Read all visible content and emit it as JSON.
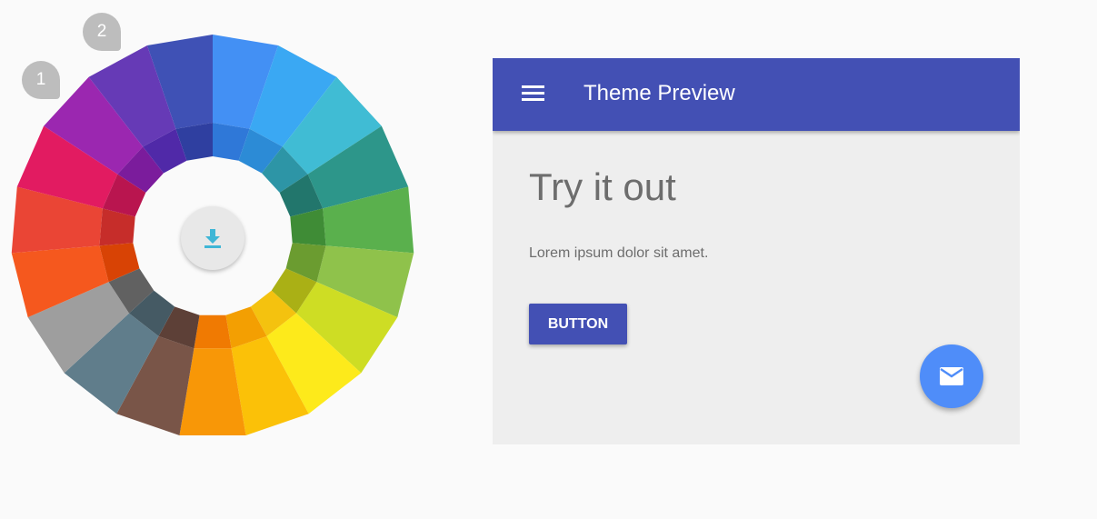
{
  "wheel": {
    "segments": [
      {
        "name": "indigo",
        "outer": "#3f51b5",
        "inner": "#2f3fa0"
      },
      {
        "name": "blue",
        "outer": "#4390f4",
        "inner": "#2f78d8"
      },
      {
        "name": "light-blue",
        "outer": "#3aa8f3",
        "inner": "#2c8bd6"
      },
      {
        "name": "cyan",
        "outer": "#40bcd4",
        "inner": "#2d95a6"
      },
      {
        "name": "teal",
        "outer": "#2d968a",
        "inner": "#22766c"
      },
      {
        "name": "green",
        "outer": "#5ab04d",
        "inner": "#3f8c36"
      },
      {
        "name": "light-green",
        "outer": "#8fc24b",
        "inner": "#6b9c30"
      },
      {
        "name": "lime",
        "outer": "#cedd24",
        "inner": "#aab015"
      },
      {
        "name": "yellow",
        "outer": "#fdea1b",
        "inner": "#f4c20f"
      },
      {
        "name": "amber",
        "outer": "#fbc108",
        "inner": "#f39f02"
      },
      {
        "name": "orange",
        "outer": "#f89707",
        "inner": "#f07a02"
      },
      {
        "name": "brown",
        "outer": "#795548",
        "inner": "#5d4037"
      },
      {
        "name": "blue-grey",
        "outer": "#607d8b",
        "inner": "#455a64"
      },
      {
        "name": "grey",
        "outer": "#9e9e9e",
        "inner": "#616161"
      },
      {
        "name": "deep-orange",
        "outer": "#f5581e",
        "inner": "#d84305"
      },
      {
        "name": "red",
        "outer": "#ea4535",
        "inner": "#c62d2a"
      },
      {
        "name": "pink",
        "outer": "#e21b61",
        "inner": "#b9154f"
      },
      {
        "name": "purple",
        "outer": "#9b27b0",
        "inner": "#7b1c9c"
      },
      {
        "name": "deep-purple",
        "outer": "#663ab6",
        "inner": "#5029a8"
      }
    ],
    "selected_labels": [
      "1",
      "2"
    ],
    "download_icon": "download-icon",
    "accent_icon_color": "#3fb6d6"
  },
  "preview": {
    "title": "Theme Preview",
    "headline": "Try it out",
    "body": "Lorem ipsum dolor sit amet.",
    "button_label": "BUTTON",
    "menu_icon": "menu-icon",
    "fab_icon": "mail-icon",
    "primary_color": "#4350b4",
    "accent_color": "#4f8df9"
  }
}
